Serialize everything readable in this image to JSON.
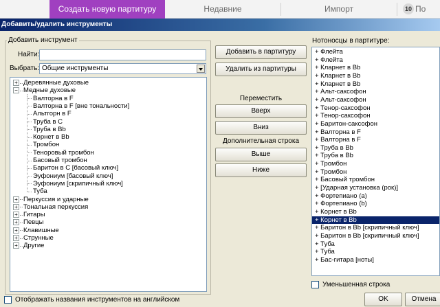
{
  "tabs": [
    {
      "label": "Создать новую партитуру",
      "active": true
    },
    {
      "label": "Недавние",
      "active": false
    },
    {
      "label": "Импорт",
      "active": false
    },
    {
      "label": "По",
      "active": false
    }
  ],
  "tab_badge": "10",
  "dialog_title": "Добавить/удалить инструменты",
  "add_group": {
    "legend": "Добавить инструмент",
    "find_label": "Найти:",
    "find_value": "",
    "choose_label": "Выбрать:",
    "choose_value": "Общие инструменты"
  },
  "tree": [
    {
      "label": "Деревянные духовые",
      "level": 0,
      "expander": "+"
    },
    {
      "label": "Медные духовые",
      "level": 0,
      "expander": "-"
    },
    {
      "label": "Валторна в F",
      "level": 1
    },
    {
      "label": "Валторна в F [вне тональности]",
      "level": 1
    },
    {
      "label": "Альтгорн в F",
      "level": 1
    },
    {
      "label": "Труба в C",
      "level": 1
    },
    {
      "label": "Труба в Bb",
      "level": 1
    },
    {
      "label": "Корнет в Bb",
      "level": 1
    },
    {
      "label": "Тромбон",
      "level": 1
    },
    {
      "label": "Теноровый тромбон",
      "level": 1
    },
    {
      "label": "Басовый тромбон",
      "level": 1
    },
    {
      "label": "Баритон в C [басовый ключ]",
      "level": 1
    },
    {
      "label": "Эуфониум [басовый ключ]",
      "level": 1
    },
    {
      "label": "Эуфониум [скрипичный ключ]",
      "level": 1
    },
    {
      "label": "Туба",
      "level": 1
    },
    {
      "label": "Перкуссия и ударные",
      "level": 0,
      "expander": "+"
    },
    {
      "label": "Тональная перкуссия",
      "level": 0,
      "expander": "+"
    },
    {
      "label": "Гитары",
      "level": 0,
      "expander": "+"
    },
    {
      "label": "Певцы",
      "level": 0,
      "expander": "+"
    },
    {
      "label": "Клавишные",
      "level": 0,
      "expander": "+"
    },
    {
      "label": "Струнные",
      "level": 0,
      "expander": "+"
    },
    {
      "label": "Другие",
      "level": 0,
      "expander": "+"
    }
  ],
  "buttons": {
    "add": "Добавить в партитуру",
    "remove": "Удалить из партитуры",
    "move_label": "Переместить",
    "up": "Вверх",
    "down": "Вниз",
    "extra_label": "Дополнительная строка",
    "above": "Выше",
    "below": "Ниже",
    "ok": "OK",
    "cancel": "Отмена"
  },
  "staves_label": "Нотоносцы в партитуре:",
  "staves": [
    "+ Флейта",
    "+ Флейта",
    "+ Кларнет в Bb",
    "+ Кларнет в Bb",
    "+ Кларнет в Bb",
    "+ Альт-саксофон",
    "+ Альт-саксофон",
    "+ Тенор-саксофон",
    "+ Тенор-саксофон",
    "+ Баритон-саксофон",
    "+ Валторна в F",
    "+ Валторна в F",
    "+ Труба в Bb",
    "+ Труба в Bb",
    "+ Тромбон",
    "+ Тромбон",
    "+ Басовый тромбон",
    "+ [Ударная установка (рок)]",
    "+ Фортепиано (a)",
    "+ Фортепиано (b)",
    "+ Корнет в Bb",
    "+ Корнет в Bb",
    "+ Баритон в Bb [скрипичный ключ]",
    "+ Баритон в Bb [скрипичный ключ]",
    "+ Туба",
    "+ Туба",
    "+ Бас-гитара [ноты]"
  ],
  "selected_staff_index": 21,
  "small_staff_label": "Уменьшенная строка",
  "english_names_label": "Отображать названия инструментов на английском",
  "colors": {
    "accent": "#a040c0",
    "selection": "#0a246a"
  }
}
